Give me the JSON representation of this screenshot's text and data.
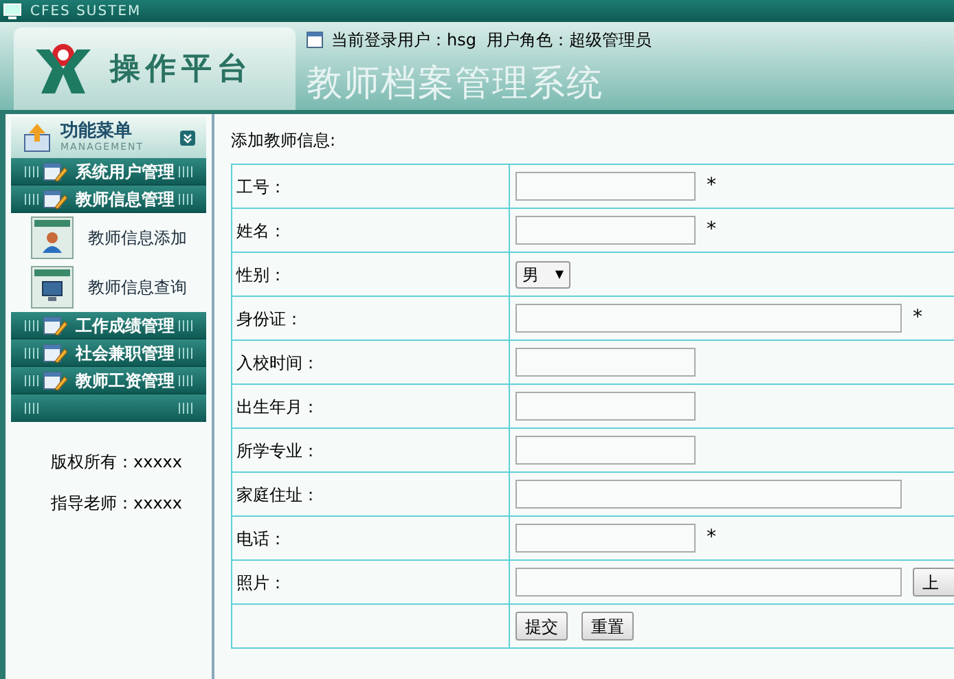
{
  "topbar": {
    "title": "CFES SUSTEM"
  },
  "header": {
    "logo_text": "操作平台",
    "user_info": "当前登录用户：hsg  用户角色：超级管理员",
    "system_title": "教师档案管理系统"
  },
  "sidebar": {
    "menu_title": "功能菜单",
    "menu_subtitle": "MANAGEMENT",
    "groups": [
      {
        "label": "系统用户管理"
      },
      {
        "label": "教师信息管理",
        "children": [
          {
            "label": "教师信息添加",
            "kind": "person"
          },
          {
            "label": "教师信息查询",
            "kind": "computer"
          }
        ]
      },
      {
        "label": "工作成绩管理"
      },
      {
        "label": "社会兼职管理"
      },
      {
        "label": "教师工资管理"
      }
    ],
    "footer": [
      "版权所有：xxxxx",
      "指导老师：xxxxx"
    ]
  },
  "form": {
    "heading": "添加教师信息:",
    "fields": [
      {
        "label": "工号：",
        "kind": "short",
        "mark": "*"
      },
      {
        "label": "姓名：",
        "kind": "short",
        "mark": "*"
      },
      {
        "label": "性别：",
        "kind": "select",
        "value": "男",
        "arrow": "▼"
      },
      {
        "label": "身份证：",
        "kind": "long",
        "mark": "*"
      },
      {
        "label": "入校时间：",
        "kind": "short"
      },
      {
        "label": "出生年月：",
        "kind": "short"
      },
      {
        "label": "所学专业：",
        "kind": "short"
      },
      {
        "label": "家庭住址：",
        "kind": "long"
      },
      {
        "label": "电话：",
        "kind": "short",
        "mark": "*"
      },
      {
        "label": "照片：",
        "kind": "file",
        "button": "上"
      }
    ],
    "buttons": [
      "提交",
      "重置"
    ]
  }
}
